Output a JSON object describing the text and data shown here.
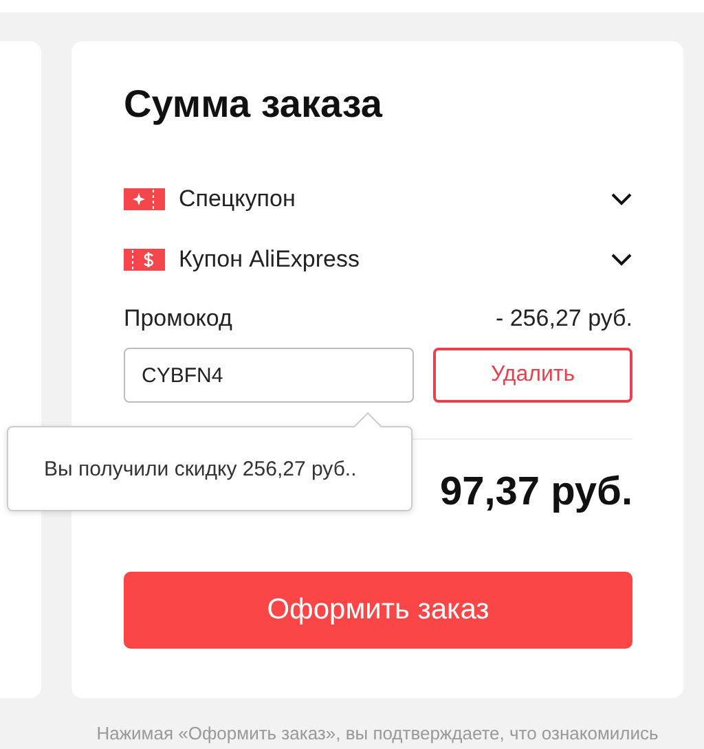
{
  "summary": {
    "title": "Сумма заказа",
    "coupons": [
      {
        "kind": "special",
        "label": "Спецкупон",
        "expanded": false
      },
      {
        "kind": "store",
        "label": "Купон AliExpress",
        "expanded": false
      }
    ],
    "promo": {
      "label": "Промокод",
      "discount": "- 256,27 руб.",
      "value": "CYBFN4",
      "remove_button": "Удалить"
    },
    "tooltip": "Вы получили скидку 256,27 руб..",
    "total": "97,37 руб.",
    "checkout_button": "Оформить заказ"
  },
  "footer_note": "Нажимая «Оформить заказ», вы подтверждаете, что ознакомились"
}
